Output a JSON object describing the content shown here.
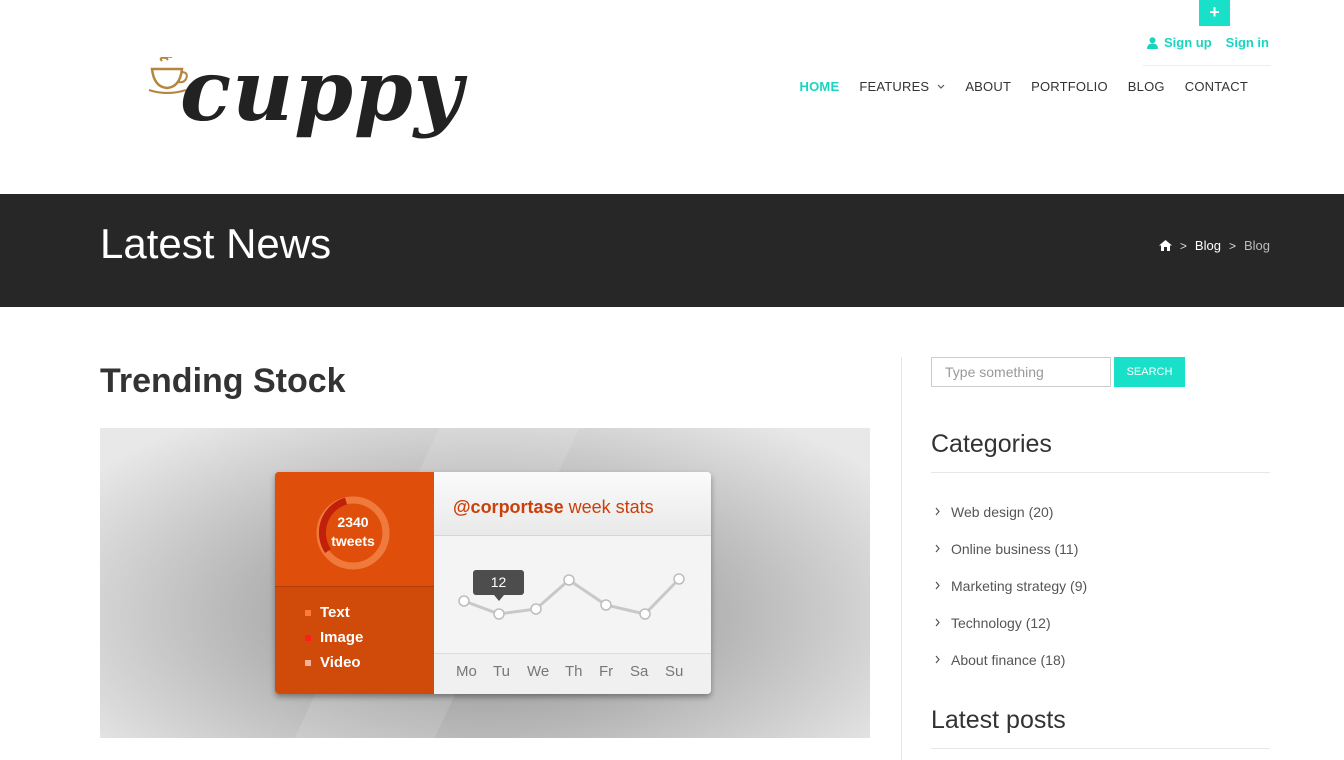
{
  "header": {
    "plus_label": "+",
    "auth": {
      "signup": "Sign up",
      "signin": "Sign in"
    },
    "logo_text": "cuppy",
    "nav": [
      {
        "label": "HOME",
        "active": true
      },
      {
        "label": "FEATURES",
        "dropdown": true
      },
      {
        "label": "ABOUT"
      },
      {
        "label": "PORTFOLIO"
      },
      {
        "label": "BLOG"
      },
      {
        "label": "CONTACT"
      }
    ]
  },
  "banner": {
    "title": "Latest News",
    "breadcrumb": {
      "home_icon": "home-icon",
      "sep": ">",
      "blog": "Blog",
      "current": "Blog"
    }
  },
  "post": {
    "title": "Trending Stock",
    "image": {
      "tweets_count": "2340",
      "tweets_label": "tweets",
      "legend": [
        "Text",
        "Image",
        "Video"
      ],
      "legend_colors": [
        "#ff7a3a",
        "#ff1e1e",
        "#f6b19a"
      ],
      "handle": "@corportase",
      "stats_label": "week stats",
      "tooltip": "12",
      "days": [
        "Mo",
        "Tu",
        "We",
        "Th",
        "Fr",
        "Sa",
        "Su"
      ]
    }
  },
  "sidebar": {
    "search": {
      "placeholder": "Type something",
      "button": "SEARCH"
    },
    "categories_title": "Categories",
    "categories": [
      "Web design (20)",
      "Online business (11)",
      "Marketing strategy (9)",
      "Technology (12)",
      "About finance (18)"
    ],
    "latest_posts_title": "Latest posts"
  },
  "colors": {
    "accent": "#19e0c8",
    "banner": "#272727",
    "widget_orange": "#e04e0b"
  }
}
